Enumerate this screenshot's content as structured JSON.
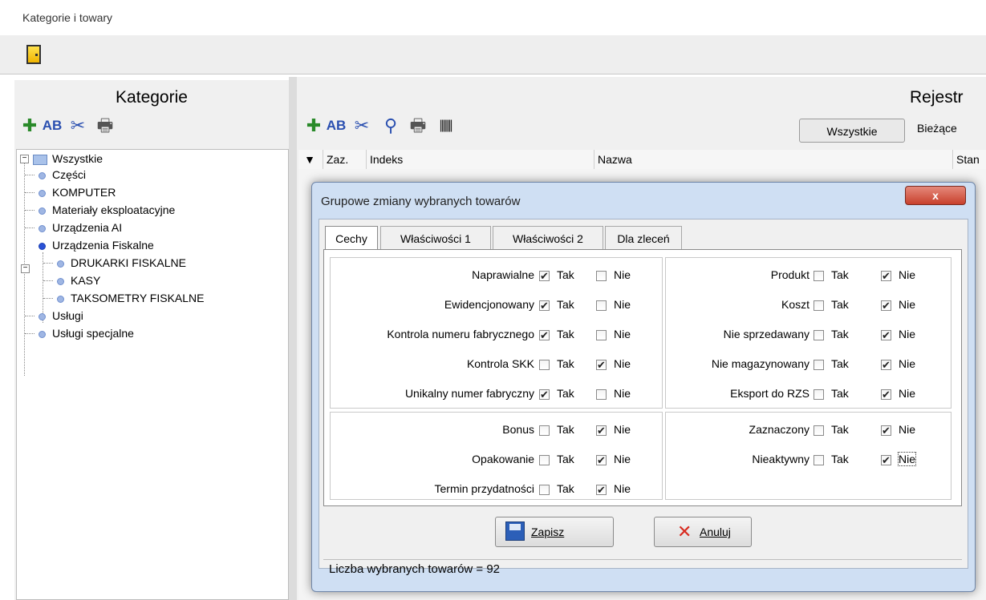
{
  "window": {
    "title": "Kategorie i towary"
  },
  "toolbar": {
    "exit_icon": "exit-door-icon"
  },
  "left_panel": {
    "header": "Kategorie",
    "tree": {
      "root": "Wszystkie",
      "items": [
        {
          "label": "Części"
        },
        {
          "label": "KOMPUTER"
        },
        {
          "label": "Materiały eksploatacyjne"
        },
        {
          "label": "Urządzenia AI"
        },
        {
          "label": "Urządzenia Fiskalne"
        },
        {
          "label": "DRUKARKI FISKALNE"
        },
        {
          "label": "KASY"
        },
        {
          "label": "TAKSOMETRY FISKALNE"
        },
        {
          "label": "Usługi"
        },
        {
          "label": "Usługi specjalne"
        }
      ]
    }
  },
  "right_panel": {
    "header": "Rejestr",
    "filter_all": "Wszystkie",
    "filter_current": "Bieżące",
    "grid_headers": {
      "zaz": "Zaz.",
      "index": "Indeks",
      "name": "Nazwa",
      "status": "Stan"
    }
  },
  "dialog": {
    "title": "Grupowe zmiany wybranych towarów",
    "close_label": "x",
    "tabs": [
      "Cechy",
      "Właściwości 1",
      "Właściwości 2",
      "Dla zleceń"
    ],
    "yes": "Tak",
    "no": "Nie",
    "left_group_1": [
      {
        "label": "Naprawialne",
        "tak": true,
        "nie": false
      },
      {
        "label": "Ewidencjonowany",
        "tak": true,
        "nie": false
      },
      {
        "label": "Kontrola numeru fabrycznego",
        "tak": true,
        "nie": false
      },
      {
        "label": "Kontrola SKK",
        "tak": false,
        "nie": true
      },
      {
        "label": "Unikalny numer fabryczny",
        "tak": true,
        "nie": false
      }
    ],
    "right_group_1": [
      {
        "label": "Produkt",
        "tak": false,
        "nie": true
      },
      {
        "label": "Koszt",
        "tak": false,
        "nie": true
      },
      {
        "label": "Nie sprzedawany",
        "tak": false,
        "nie": true
      },
      {
        "label": "Nie magazynowany",
        "tak": false,
        "nie": true
      },
      {
        "label": "Eksport do RZS",
        "tak": false,
        "nie": true
      }
    ],
    "left_group_2": [
      {
        "label": "Bonus",
        "tak": false,
        "nie": true
      },
      {
        "label": "Opakowanie",
        "tak": false,
        "nie": true
      },
      {
        "label": "Termin przydatności",
        "tak": false,
        "nie": true
      }
    ],
    "right_group_2": [
      {
        "label": "Zaznaczony",
        "tak": false,
        "nie": true
      },
      {
        "label": "Nieaktywny",
        "tak": false,
        "nie": true
      }
    ],
    "save_label": "Zapisz",
    "cancel_label": "Anuluj",
    "status": "Liczba wybranych towarów = 92"
  }
}
